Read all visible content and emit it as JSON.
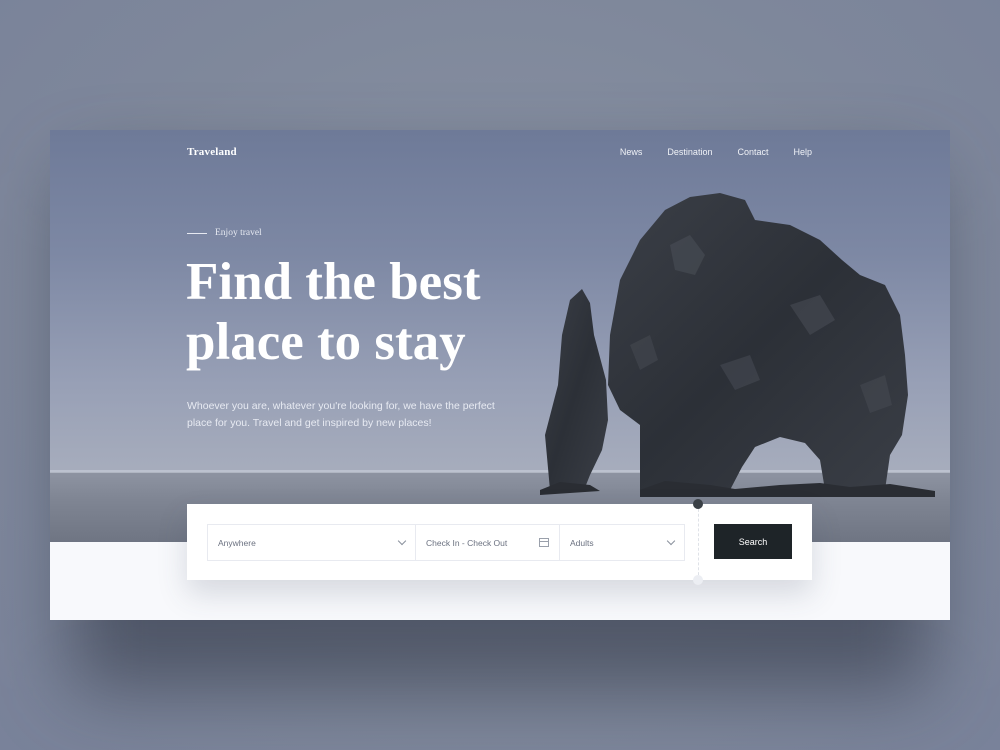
{
  "brand": "Traveland",
  "nav": [
    "News",
    "Destination",
    "Contact",
    "Help"
  ],
  "hero": {
    "eyebrow": "Enjoy travel",
    "headline_line1": "Find the best",
    "headline_line2": "place to stay",
    "subtext": "Whoever you are, whatever you're looking for, we have the perfect place for you. Travel and get inspired by new places!"
  },
  "search": {
    "location_value": "Anywhere",
    "dates_value": "Check In - Check Out",
    "guests_value": "Adults",
    "button_label": "Search"
  },
  "icons": {
    "location_dropdown": "chevron-down-icon",
    "dates": "calendar-icon",
    "guests_dropdown": "chevron-down-icon"
  },
  "colors": {
    "button": "#1e2428",
    "hero_sky": "#7d88a4"
  }
}
